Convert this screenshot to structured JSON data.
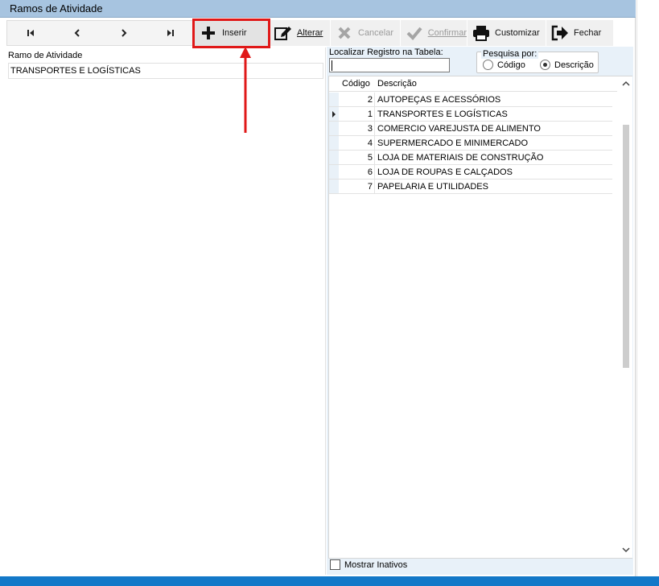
{
  "window": {
    "title": "Ramos de Atividade"
  },
  "toolbar": {
    "nav": [
      {
        "name": "first-record-button",
        "glyph": "⏮",
        "icon": "first-icon"
      },
      {
        "name": "prev-record-button",
        "glyph": "‹",
        "icon": "prev-icon"
      },
      {
        "name": "next-record-button",
        "glyph": "›",
        "icon": "next-icon"
      },
      {
        "name": "last-record-button",
        "glyph": "⏭",
        "icon": "last-icon"
      }
    ],
    "inserir": "Inserir",
    "alterar": "Alterar",
    "cancelar": "Cancelar",
    "confirmar": "Confirmar",
    "customizar": "Customizar",
    "fechar": "Fechar"
  },
  "form": {
    "ramo_label": "Ramo de Atividade",
    "ramo_value": "TRANSPORTES E LOGÍSTICAS"
  },
  "search": {
    "label": "Localizar Registro na Tabela:",
    "value": "",
    "group_title": "Pesquisa por:",
    "options": [
      "Código",
      "Descrição"
    ],
    "selected": "Descrição"
  },
  "table": {
    "columns": [
      "Código",
      "Descrição"
    ],
    "rows": [
      {
        "codigo": "2",
        "descricao": "AUTOPEÇAS E ACESSÓRIOS",
        "current": false
      },
      {
        "codigo": "1",
        "descricao": "TRANSPORTES E LOGÍSTICAS",
        "current": true
      },
      {
        "codigo": "3",
        "descricao": "COMERCIO VAREJUSTA DE ALIMENTO",
        "current": false
      },
      {
        "codigo": "4",
        "descricao": "SUPERMERCADO E MINIMERCADO",
        "current": false
      },
      {
        "codigo": "5",
        "descricao": "LOJA DE MATERIAIS DE CONSTRUÇÃO",
        "current": false
      },
      {
        "codigo": "6",
        "descricao": "LOJA DE ROUPAS E CALÇADOS",
        "current": false
      },
      {
        "codigo": "7",
        "descricao": "PAPELARIA E UTILIDADES",
        "current": false
      }
    ]
  },
  "footer": {
    "mostrar_inativos": "Mostrar Inativos"
  },
  "colors": {
    "titlebar": "#a7c4e0",
    "highlight": "#e01818",
    "taskbar": "#1378c8"
  }
}
